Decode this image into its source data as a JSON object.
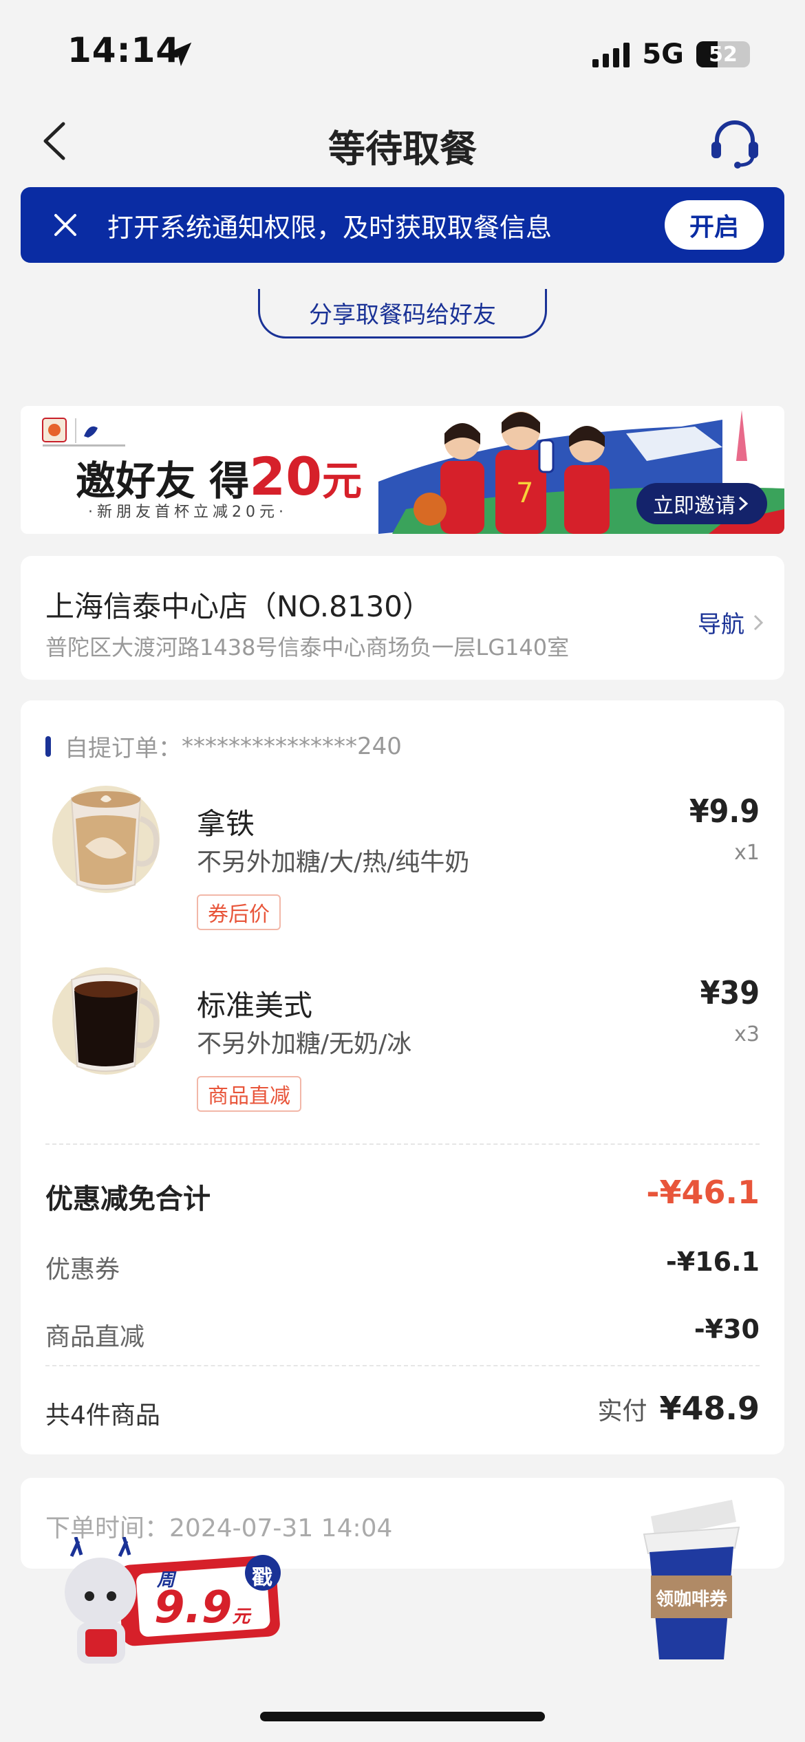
{
  "status": {
    "time": "14:14",
    "network": "5G",
    "battery": "52"
  },
  "nav": {
    "title": "等待取餐"
  },
  "notify": {
    "text": "打开系统通知权限，及时获取取餐信息",
    "button": "开启"
  },
  "share": {
    "label": "分享取餐码给好友"
  },
  "ad": {
    "title_prefix": "邀好友 得",
    "amount": "20",
    "unit": "元",
    "subtitle": "·新朋友首杯立减20元·",
    "button": "立即邀请"
  },
  "store": {
    "name": "上海信泰中心店（NO.8130）",
    "address": "普陀区大渡河路1438号信泰中心商场负一层LG140室",
    "nav_label": "导航"
  },
  "order": {
    "label": "自提订单：",
    "number": "***************240",
    "items": [
      {
        "name": "拿铁",
        "spec": "不另外加糖/大/热/纯牛奶",
        "tag": "券后价",
        "price": "¥9.9",
        "qty": "x1"
      },
      {
        "name": "标准美式",
        "spec": "不另外加糖/无奶/冰",
        "tag": "商品直减",
        "price": "¥39",
        "qty": "x3"
      }
    ],
    "discount_total_label": "优惠减免合计",
    "discount_total": "-¥46.1",
    "coupon_label": "优惠券",
    "coupon": "-¥16.1",
    "direct_label": "商品直减",
    "direct": "-¥30",
    "count_label": "共4件商品",
    "paid_label": "实付",
    "paid": "¥48.9"
  },
  "order_time": {
    "label": "下单时间：",
    "value": "2024-07-31 14:04"
  },
  "promos": {
    "left_top": "周",
    "left_badge": "戳",
    "left_price": "9.9",
    "left_unit": "元",
    "right_label": "领咖啡券"
  },
  "colors": {
    "brand_blue": "#0a2ca3",
    "accent_red": "#e8553a"
  }
}
